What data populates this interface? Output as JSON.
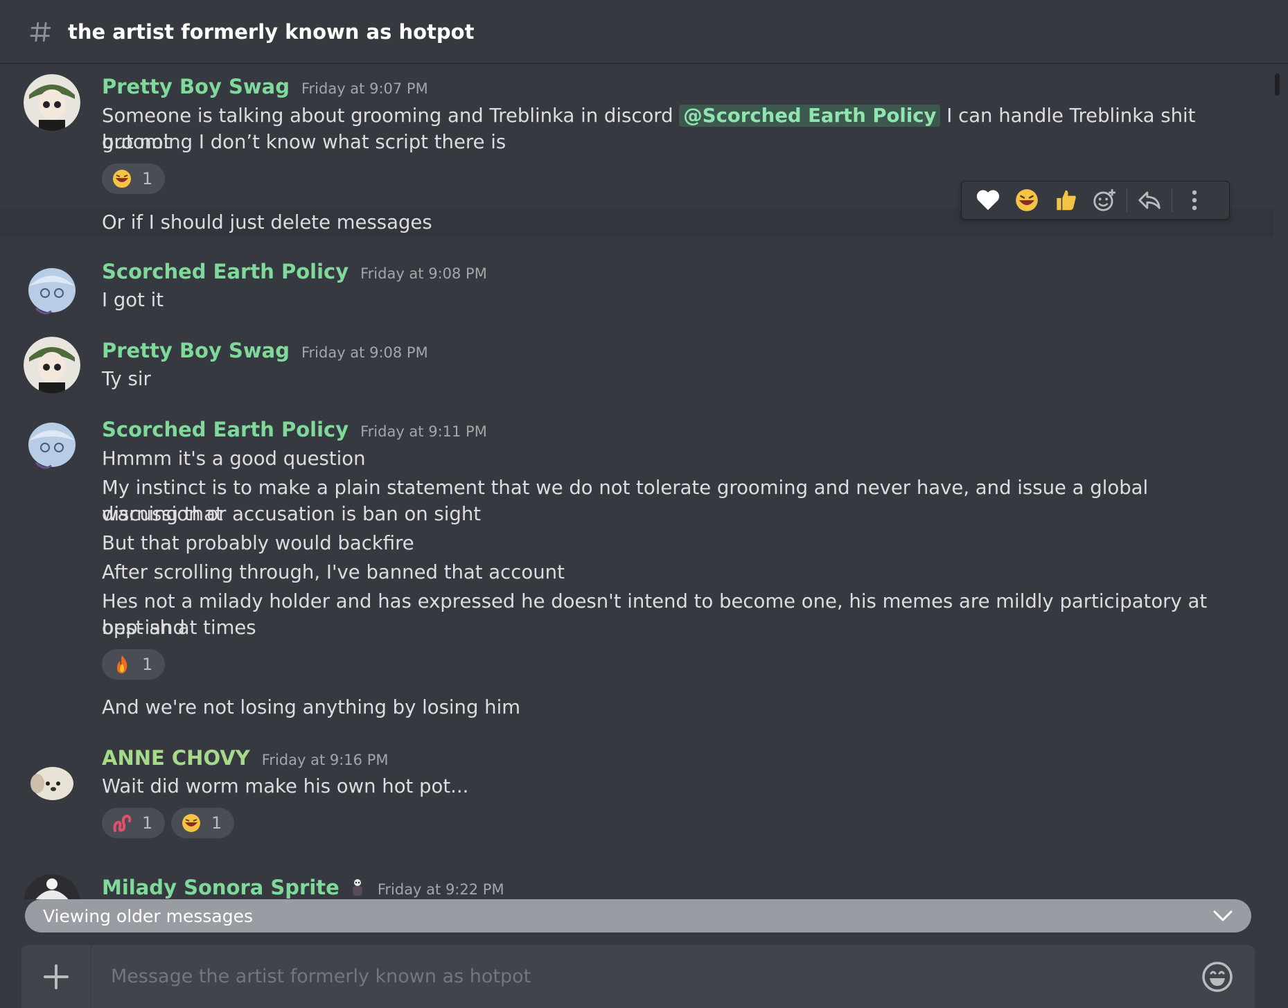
{
  "channel": {
    "name": "the artist formerly known as hotpot"
  },
  "messages": [
    {
      "author": "Pretty Boy Swag",
      "timestamp": "Friday at 9:07 PM",
      "line1_before": "Someone is talking about grooming and Treblinka in discord ",
      "mention": "@Scorched Earth Policy",
      "line1_after": " I can handle Treblinka shit but not",
      "line2": "grooming I don’t know what script there is",
      "reaction": {
        "emoji": "laughing-emoji",
        "count": "1"
      },
      "followup": "Or if I should just delete messages"
    },
    {
      "author": "Scorched Earth Policy",
      "timestamp": "Friday at 9:08 PM",
      "text": "I got it"
    },
    {
      "author": "Pretty Boy Swag",
      "timestamp": "Friday at 9:08 PM",
      "text": "Ty sir"
    },
    {
      "author": "Scorched Earth Policy",
      "timestamp": "Friday at 9:11 PM",
      "lines": [
        "Hmmm it's a good question",
        "My instinct is to make a plain statement that we do not tolerate grooming and never have, and issue a global warning that",
        "discussion or accusation is ban on sight",
        "But that probably would backfire",
        "After scrolling through, I've banned that account",
        "Hes not a milady holder and has expressed he doesn't intend to become one, his memes are mildly participatory at best and",
        "opp-ish at times"
      ],
      "reaction": {
        "emoji": "fire-emoji",
        "count": "1"
      },
      "followup": "And we're not losing anything by losing him"
    },
    {
      "author": "ANNE CHOVY",
      "timestamp": "Friday at 9:16 PM",
      "text": "Wait did worm make his own hot pot...",
      "reactions": [
        {
          "emoji": "worm-emoji",
          "count": "1"
        },
        {
          "emoji": "laughing-emoji",
          "count": "1"
        }
      ]
    },
    {
      "author": "Milady Sonora Sprite",
      "timestamp": "Friday at 9:22 PM",
      "badge": "sprite-badge-icon"
    }
  ],
  "hover_toolbar": [
    "heart-icon",
    "laughing-icon",
    "thumbs-up-icon",
    "add-reaction-icon",
    "reply-icon",
    "more-icon"
  ],
  "older_bar": {
    "text": "Viewing older messages"
  },
  "composer": {
    "placeholder": "Message the artist formerly known as hotpot"
  },
  "colors": {
    "background": "#36393f",
    "username": "#7ed99a",
    "mention_bg": "#2f5a43",
    "older_bar": "#9a9ca4"
  }
}
